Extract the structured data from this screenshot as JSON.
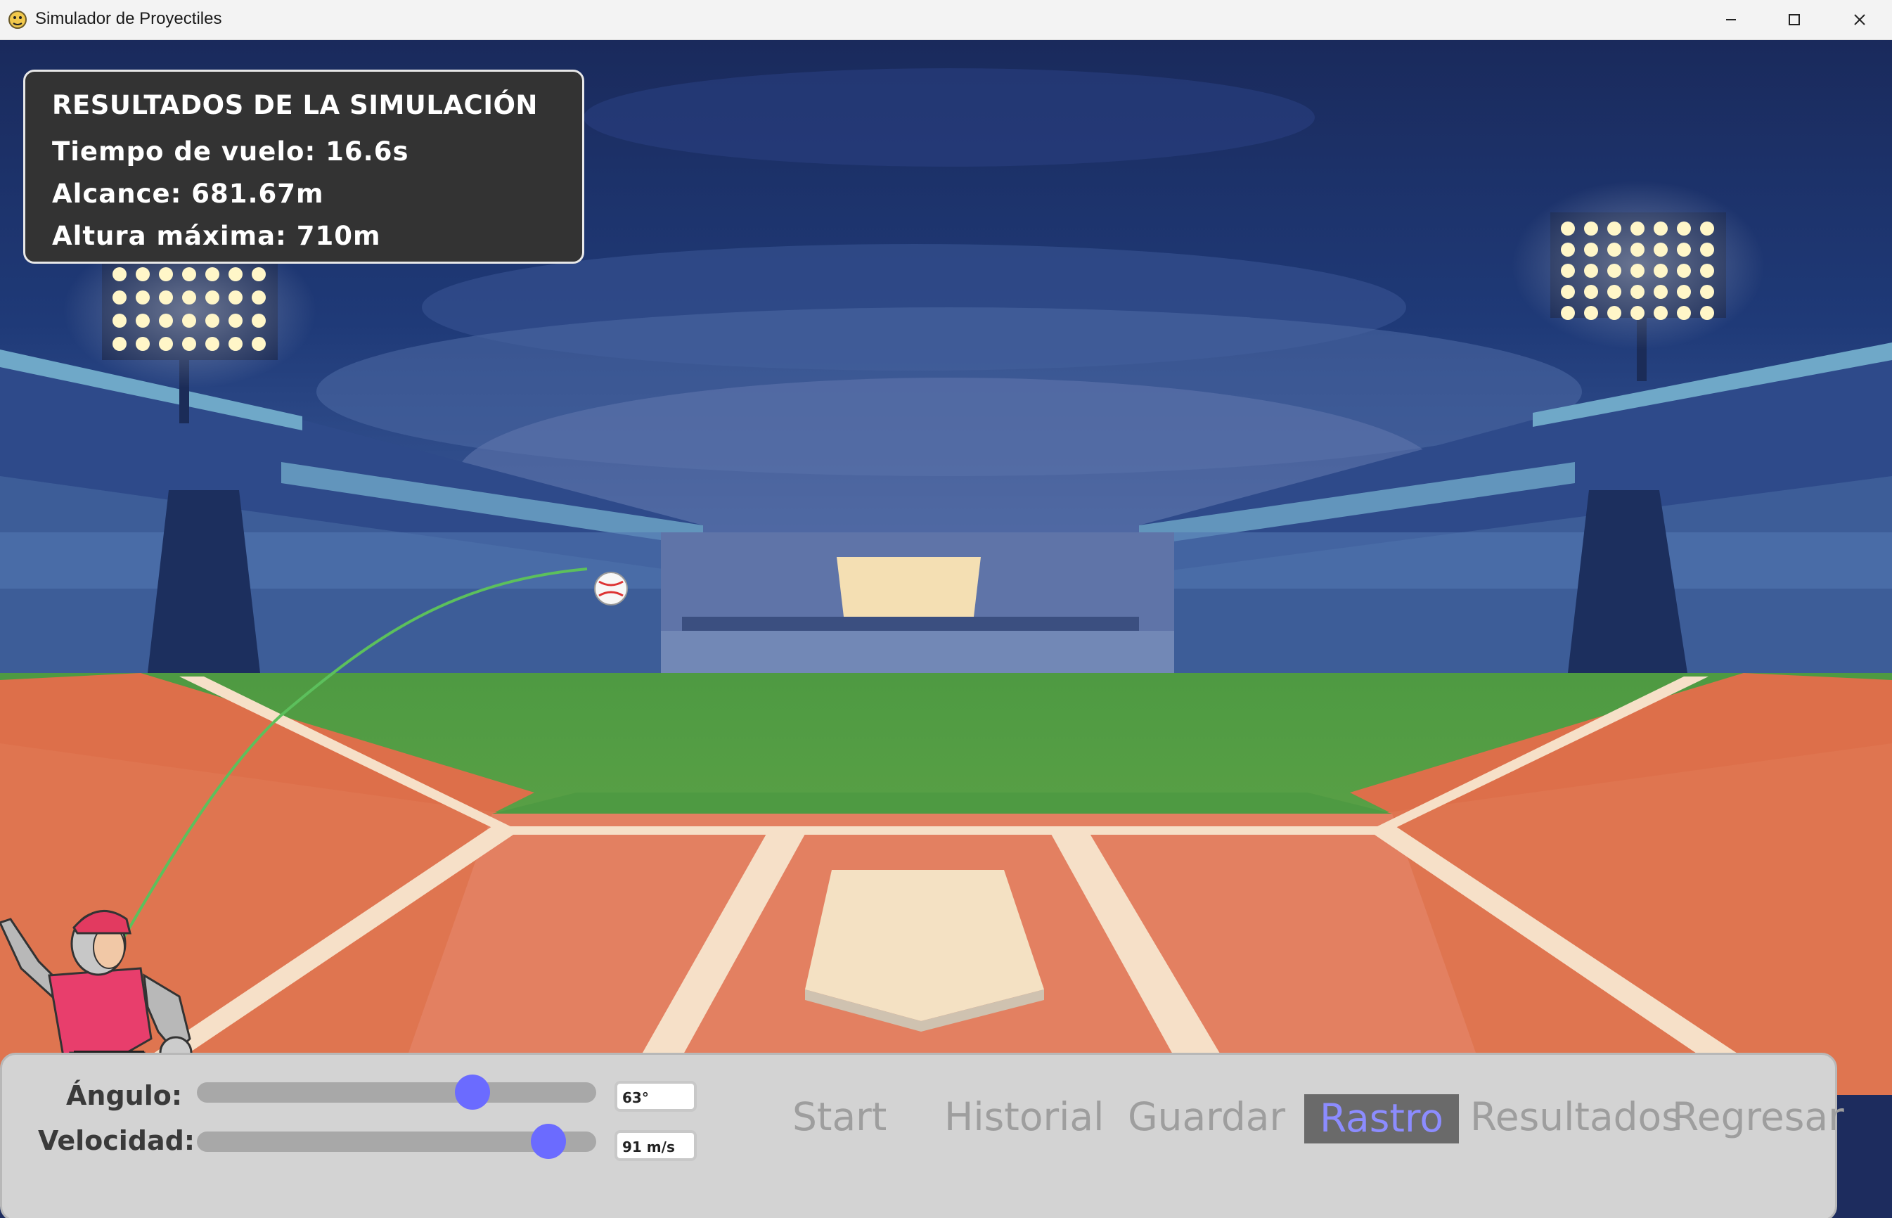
{
  "window": {
    "title": "Simulador de Proyectiles",
    "icon": "pygame-snake-icon",
    "buttons": [
      "minimize-icon",
      "maximize-icon",
      "close-icon"
    ]
  },
  "results": {
    "title": "RESULTADOS DE LA SIMULACIÓN",
    "flight_time": "Tiempo de vuelo: 16.6s",
    "range": "Alcance: 681.67m",
    "max_height": "Altura máxima: 710m"
  },
  "controls": {
    "angle_label": "Ángulo:",
    "speed_label": "Velocidad:",
    "angle_value": "63°",
    "speed_value": "91 m/s",
    "angle_slider_fraction": 0.69,
    "speed_slider_fraction": 0.88,
    "knob_color": "#6b6bff"
  },
  "menu": {
    "start": "Start",
    "historial": "Historial",
    "guardar": "Guardar",
    "rastro": "Rastro",
    "resultados": "Resultados",
    "regresar": "Regresar",
    "active": "Rastro",
    "active_color": "#8c8cff",
    "inactive_color": "#9e9e9e"
  },
  "scene": {
    "background": "baseball-stadium-night",
    "trajectory_color": "#5cc05c",
    "ball": "baseball-icon",
    "player": "baseball-pitcher"
  }
}
